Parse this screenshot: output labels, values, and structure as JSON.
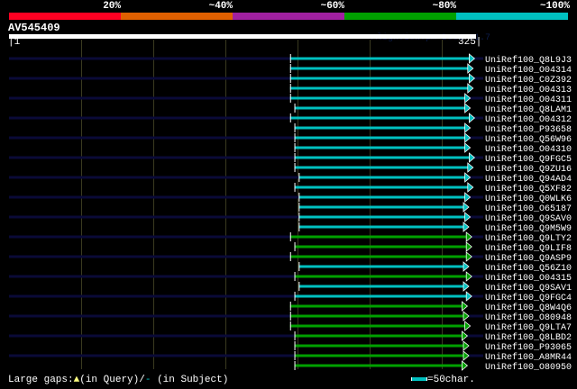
{
  "coverage_legend": {
    "labels": [
      "20%",
      "~40%",
      "~60%",
      "~80%",
      "~100%"
    ],
    "colors": [
      "#ff0022",
      "#e06000",
      "#a020a0",
      "#00a000",
      "#00c0c0"
    ]
  },
  "query": {
    "name": "AV545409",
    "start_label": "|1",
    "end_label": "325|",
    "length": 325
  },
  "watermark": "AlignView.pm Beta r1.7",
  "hit_colors": {
    "cyan": "#00c0c0",
    "green": "#00a000",
    "rail": "#0a0a38",
    "grid": "#3a3a20"
  },
  "hits": [
    {
      "name": "UniRef100_Q8L9J3",
      "start": 196,
      "end": 324,
      "color": "cyan"
    },
    {
      "name": "UniRef100_O04314",
      "start": 196,
      "end": 323,
      "color": "cyan"
    },
    {
      "name": "UniRef100_C0Z392",
      "start": 196,
      "end": 324,
      "color": "cyan"
    },
    {
      "name": "UniRef100_O04313",
      "start": 196,
      "end": 323,
      "color": "cyan"
    },
    {
      "name": "UniRef100_O04311",
      "start": 196,
      "end": 321,
      "color": "cyan"
    },
    {
      "name": "UniRef100_Q8LAM1",
      "start": 199,
      "end": 321,
      "color": "cyan"
    },
    {
      "name": "UniRef100_O04312",
      "start": 196,
      "end": 324,
      "color": "cyan"
    },
    {
      "name": "UniRef100_P93658",
      "start": 199,
      "end": 321,
      "color": "cyan"
    },
    {
      "name": "UniRef100_Q56W96",
      "start": 199,
      "end": 321,
      "color": "cyan"
    },
    {
      "name": "UniRef100_O04310",
      "start": 199,
      "end": 321,
      "color": "cyan"
    },
    {
      "name": "UniRef100_Q9FGC5",
      "start": 199,
      "end": 324,
      "color": "cyan"
    },
    {
      "name": "UniRef100_Q9ZU16",
      "start": 199,
      "end": 323,
      "color": "cyan"
    },
    {
      "name": "UniRef100_Q94AD4",
      "start": 202,
      "end": 321,
      "color": "cyan"
    },
    {
      "name": "UniRef100_Q5XF82",
      "start": 199,
      "end": 323,
      "color": "cyan"
    },
    {
      "name": "UniRef100_Q0WLK6",
      "start": 202,
      "end": 321,
      "color": "cyan"
    },
    {
      "name": "UniRef100_O65187",
      "start": 202,
      "end": 320,
      "color": "cyan"
    },
    {
      "name": "UniRef100_Q9SAV0",
      "start": 202,
      "end": 321,
      "color": "cyan"
    },
    {
      "name": "UniRef100_Q9M5W9",
      "start": 202,
      "end": 320,
      "color": "cyan"
    },
    {
      "name": "UniRef100_Q9LTY2",
      "start": 196,
      "end": 322,
      "color": "green"
    },
    {
      "name": "UniRef100_Q9LIF8",
      "start": 199,
      "end": 322,
      "color": "green"
    },
    {
      "name": "UniRef100_Q9ASP9",
      "start": 196,
      "end": 322,
      "color": "green"
    },
    {
      "name": "UniRef100_Q56Z10",
      "start": 202,
      "end": 320,
      "color": "cyan"
    },
    {
      "name": "UniRef100_O04315",
      "start": 199,
      "end": 322,
      "color": "green"
    },
    {
      "name": "UniRef100_Q9SAV1",
      "start": 202,
      "end": 320,
      "color": "cyan"
    },
    {
      "name": "UniRef100_Q9FGC4",
      "start": 199,
      "end": 322,
      "color": "cyan"
    },
    {
      "name": "UniRef100_Q8W4Q6",
      "start": 196,
      "end": 319,
      "color": "green"
    },
    {
      "name": "UniRef100_O80948",
      "start": 196,
      "end": 320,
      "color": "green"
    },
    {
      "name": "UniRef100_Q9LTA7",
      "start": 196,
      "end": 321,
      "color": "green"
    },
    {
      "name": "UniRef100_Q8LBD2",
      "start": 199,
      "end": 319,
      "color": "green"
    },
    {
      "name": "UniRef100_P93065",
      "start": 199,
      "end": 320,
      "color": "green"
    },
    {
      "name": "UniRef100_A8MR44",
      "start": 199,
      "end": 320,
      "color": "green"
    },
    {
      "name": "UniRef100_O80950",
      "start": 199,
      "end": 319,
      "color": "green"
    }
  ],
  "footer": {
    "gaps_label": "Large gaps:",
    "query_gap": "(in Query)/",
    "subject_gap": "(in Subject)",
    "scale_label": "=50char."
  }
}
